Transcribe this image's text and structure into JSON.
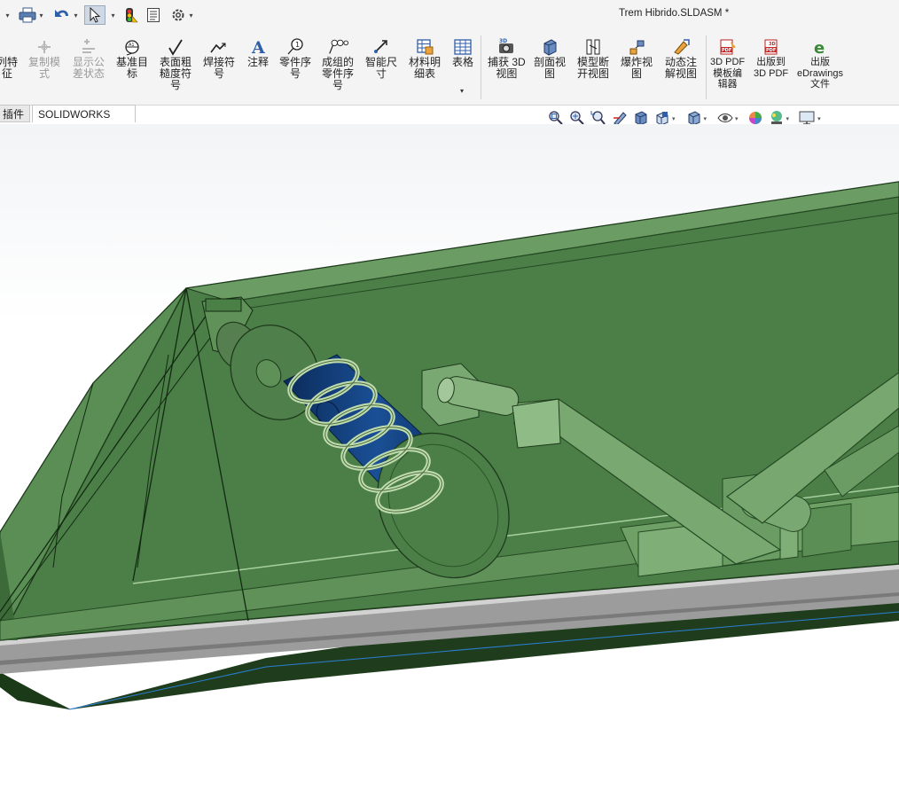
{
  "window": {
    "title": "Trem Hibrido.SLDASM *"
  },
  "quick_access": {
    "icons": [
      "print-icon",
      "undo-icon",
      "select-pointer-icon",
      "rebuild-traffic-light-icon",
      "file-properties-icon",
      "options-gear-icon"
    ]
  },
  "ribbon": {
    "items": [
      {
        "label": "列特\n征",
        "icon": "linear-pattern-icon",
        "disabled": false
      },
      {
        "label": "复制模\n式",
        "icon": "copy-mode-icon",
        "disabled": true
      },
      {
        "label": "显示公\n差状态",
        "icon": "tolerance-status-icon",
        "disabled": true
      },
      {
        "label": "基准目\n标",
        "icon": "datum-target-icon",
        "disabled": false
      },
      {
        "label": "表面粗\n糙度符\n号",
        "icon": "surface-finish-icon",
        "disabled": false
      },
      {
        "label": "焊接符\n号",
        "icon": "weld-symbol-icon",
        "disabled": false
      },
      {
        "label": "注释",
        "icon": "note-icon",
        "disabled": false
      },
      {
        "label": "零件序\n号",
        "icon": "balloon-icon",
        "disabled": false
      },
      {
        "label": "成组的\n零件序\n号",
        "icon": "stacked-balloon-icon",
        "disabled": false
      },
      {
        "label": "智能尺\n寸",
        "icon": "smart-dimension-icon",
        "disabled": false
      },
      {
        "label": "材料明\n细表",
        "icon": "bill-of-materials-icon",
        "disabled": false
      },
      {
        "label": "表格",
        "icon": "table-icon",
        "disabled": false
      },
      {
        "label": "捕获 3D\n视图",
        "icon": "capture-3d-view-icon",
        "disabled": false
      },
      {
        "label": "剖面视\n图",
        "icon": "section-view-icon",
        "disabled": false
      },
      {
        "label": "模型断\n开视图",
        "icon": "model-break-view-icon",
        "disabled": false
      },
      {
        "label": "爆炸视\n图",
        "icon": "exploded-view-icon",
        "disabled": false
      },
      {
        "label": "动态注\n解视图",
        "icon": "dynamic-annotation-view-icon",
        "disabled": false
      },
      {
        "label": "3D PDF\n模板编\n辑器",
        "icon": "3d-pdf-template-icon",
        "disabled": false
      },
      {
        "label": "出版到\n3D PDF",
        "icon": "publish-3d-pdf-icon",
        "disabled": false
      },
      {
        "label": "出版\neDrawings\n文件",
        "icon": "edrawings-icon",
        "disabled": false
      }
    ]
  },
  "tabs": [
    {
      "label": "插件",
      "active": false
    },
    {
      "label": "SOLIDWORKS MBD",
      "active": true
    }
  ],
  "view_toolbar": {
    "icons": [
      "zoom-to-fit-icon",
      "zoom-to-area-icon",
      "previous-view-icon",
      "section-view-hud-icon",
      "dynamic-annotation-hud-icon",
      "view-orientation-icon",
      "display-style-icon",
      "hide-show-items-icon",
      "edit-appearance-icon",
      "apply-scene-icon",
      "view-settings-icon"
    ]
  },
  "colors": {
    "chassis_green": "#4c7f48",
    "chassis_dark": "#2c5a2a",
    "shock_blue": "#0d3a78",
    "spring_green": "#bfdcae",
    "frame_gray": "#9c9c9c",
    "accent_blue": "#2a7fd4"
  }
}
